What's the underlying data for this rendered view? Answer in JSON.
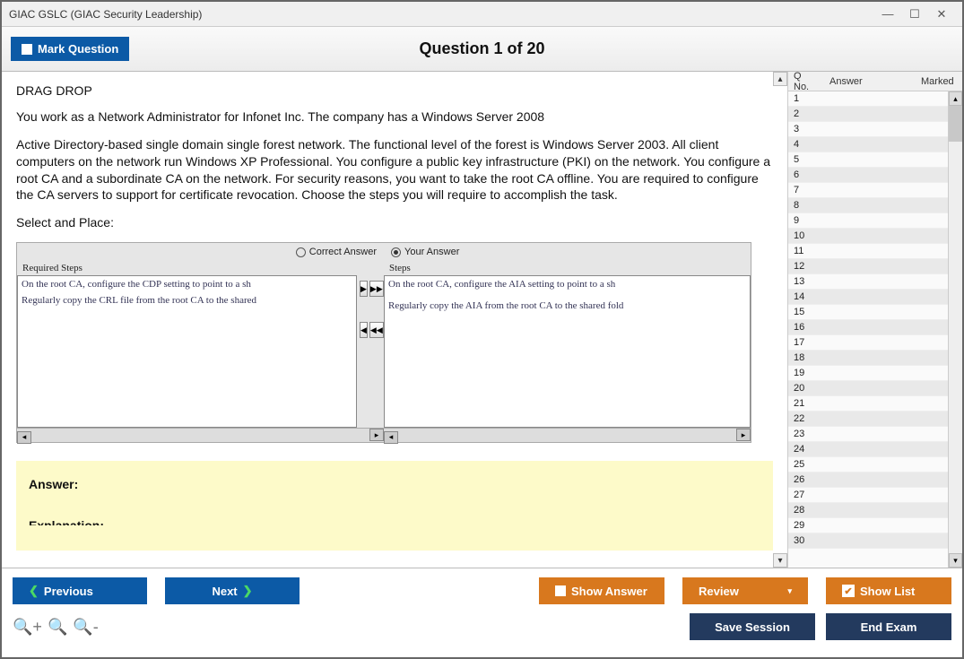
{
  "window_title": "GIAC GSLC (GIAC Security Leadership)",
  "header": {
    "mark_label": "Mark Question",
    "question_title": "Question 1 of 20"
  },
  "question": {
    "type_heading": "DRAG DROP",
    "p1": "You work as a Network Administrator for Infonet Inc. The company has a Windows Server 2008",
    "p2": "Active Directory-based single domain single forest network. The functional level of the forest is Windows Server 2003. All client computers on the network run Windows XP Professional. You configure a public key infrastructure (PKI) on the network. You configure a root CA and a subordinate CA on the network. For security reasons, you want to take the root CA offline. You are required to configure the CA servers to support for certificate revocation. Choose the steps you will require to accomplish the task.",
    "p3": "Select and Place:"
  },
  "dragdrop": {
    "correct_label": "Correct Answer",
    "your_label": "Your Answer",
    "left_header": "Required Steps",
    "right_header": "Steps",
    "left_items": [
      "On the root CA, configure the CDP setting to point to a sh",
      "Regularly copy the CRL file from the root CA to the shared"
    ],
    "right_items": [
      "On the root CA, configure the AIA setting to point to a sh",
      "",
      "Regularly copy the AIA from the root CA to the shared fold"
    ]
  },
  "answer": {
    "label": "Answer:",
    "explanation_label": "Explanation:"
  },
  "sidebar": {
    "h1": "Q No.",
    "h2": "Answer",
    "h3": "Marked",
    "rows": [
      "1",
      "2",
      "3",
      "4",
      "5",
      "6",
      "7",
      "8",
      "9",
      "10",
      "11",
      "12",
      "13",
      "14",
      "15",
      "16",
      "17",
      "18",
      "19",
      "20",
      "21",
      "22",
      "23",
      "24",
      "25",
      "26",
      "27",
      "28",
      "29",
      "30"
    ]
  },
  "footer": {
    "previous": "Previous",
    "next": "Next",
    "show_answer": "Show Answer",
    "review": "Review",
    "show_list": "Show List",
    "save_session": "Save Session",
    "end_exam": "End Exam"
  }
}
